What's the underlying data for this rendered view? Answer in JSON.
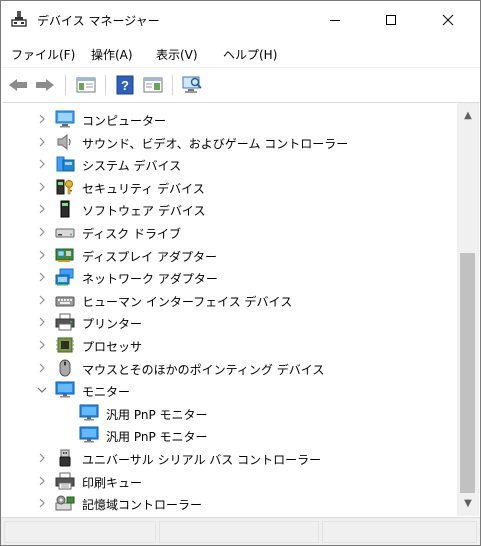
{
  "window": {
    "title": "デバイス マネージャー"
  },
  "menu": {
    "items": [
      "ファイル(F)",
      "操作(A)",
      "表示(V)",
      "ヘルプ(H)"
    ]
  },
  "toolbar": {
    "icons": [
      "back-arrow-icon",
      "forward-arrow-icon",
      "properties-icon",
      "help-icon",
      "view-icon",
      "scan-hardware-icon"
    ]
  },
  "tree": {
    "rows": [
      {
        "label": "コンピューター",
        "icon": "computer-icon",
        "expanded": false,
        "level": 0
      },
      {
        "label": "サウンド、ビデオ、およびゲーム コントローラー",
        "icon": "speaker-icon",
        "expanded": false,
        "level": 0
      },
      {
        "label": "システム デバイス",
        "icon": "system-device-icon",
        "expanded": false,
        "level": 0
      },
      {
        "label": "セキュリティ デバイス",
        "icon": "security-key-icon",
        "expanded": false,
        "level": 0
      },
      {
        "label": "ソフトウェア デバイス",
        "icon": "software-device-icon",
        "expanded": false,
        "level": 0
      },
      {
        "label": "ディスク ドライブ",
        "icon": "disk-drive-icon",
        "expanded": false,
        "level": 0
      },
      {
        "label": "ディスプレイ アダプター",
        "icon": "display-adapter-icon",
        "expanded": false,
        "level": 0
      },
      {
        "label": "ネットワーク アダプター",
        "icon": "network-adapter-icon",
        "expanded": false,
        "level": 0
      },
      {
        "label": "ヒューマン インターフェイス デバイス",
        "icon": "hid-icon",
        "expanded": false,
        "level": 0
      },
      {
        "label": "プリンター",
        "icon": "printer-icon",
        "expanded": false,
        "level": 0
      },
      {
        "label": "プロセッサ",
        "icon": "processor-icon",
        "expanded": false,
        "level": 0
      },
      {
        "label": "マウスとそのほかのポインティング デバイス",
        "icon": "mouse-icon",
        "expanded": false,
        "level": 0
      },
      {
        "label": "モニター",
        "icon": "monitor-icon",
        "expanded": true,
        "level": 0
      },
      {
        "label": "汎用 PnP モニター",
        "icon": "monitor-icon",
        "expanded": null,
        "level": 1
      },
      {
        "label": "汎用 PnP モニター",
        "icon": "monitor-icon",
        "expanded": null,
        "level": 1
      },
      {
        "label": "ユニバーサル シリアル バス コントローラー",
        "icon": "usb-icon",
        "expanded": false,
        "level": 0
      },
      {
        "label": "印刷キュー",
        "icon": "print-queue-icon",
        "expanded": false,
        "level": 0
      },
      {
        "label": "記憶域コントローラー",
        "icon": "storage-controller-icon",
        "expanded": false,
        "level": 0
      }
    ]
  },
  "colors": {
    "accent": "#0078d7",
    "monitor_blue": "#1e90ff"
  }
}
